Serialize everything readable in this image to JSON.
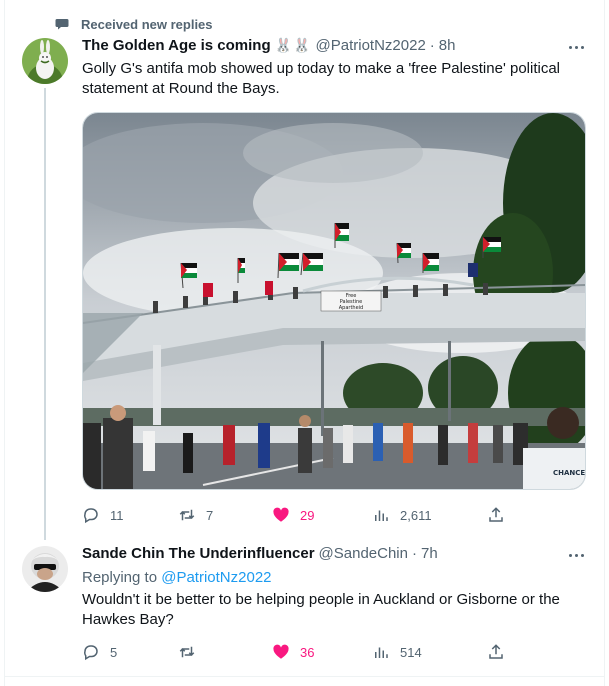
{
  "notice": {
    "label": "Received new replies",
    "icon": "speech-bubble-icon"
  },
  "tweets": [
    {
      "name": "The Golden Age is coming",
      "badge": "🐰🐰",
      "handle": "@PatriotNz2022",
      "dot": "·",
      "time": "8h",
      "text": "Golly G's antifa mob showed up today to make a 'free Palestine' political statement at Round the Bays.",
      "media": {
        "banner_line1": "Free",
        "banner_line2": "Palestine",
        "banner_line3": "Apartheid",
        "shirt_text": "CHANCES"
      },
      "stats": {
        "replies": "11",
        "retweets": "7",
        "likes": "29",
        "views": "2,611"
      }
    },
    {
      "name": "Sande Chin The Underinfluencer",
      "handle": "@SandeChin",
      "dot": "·",
      "time": "7h",
      "replying_label": "Replying to",
      "replying_handle": "@PatriotNz2022",
      "text": "Wouldn't it be better to be helping people in Auckland or Gisborne or the Hawkes Bay?",
      "stats": {
        "replies": "5",
        "retweets": "",
        "likes": "36",
        "views": "514"
      }
    }
  ],
  "colors": {
    "like": "#f91880",
    "link": "#1d9bf0",
    "muted": "#536471",
    "text": "#0f1419"
  }
}
